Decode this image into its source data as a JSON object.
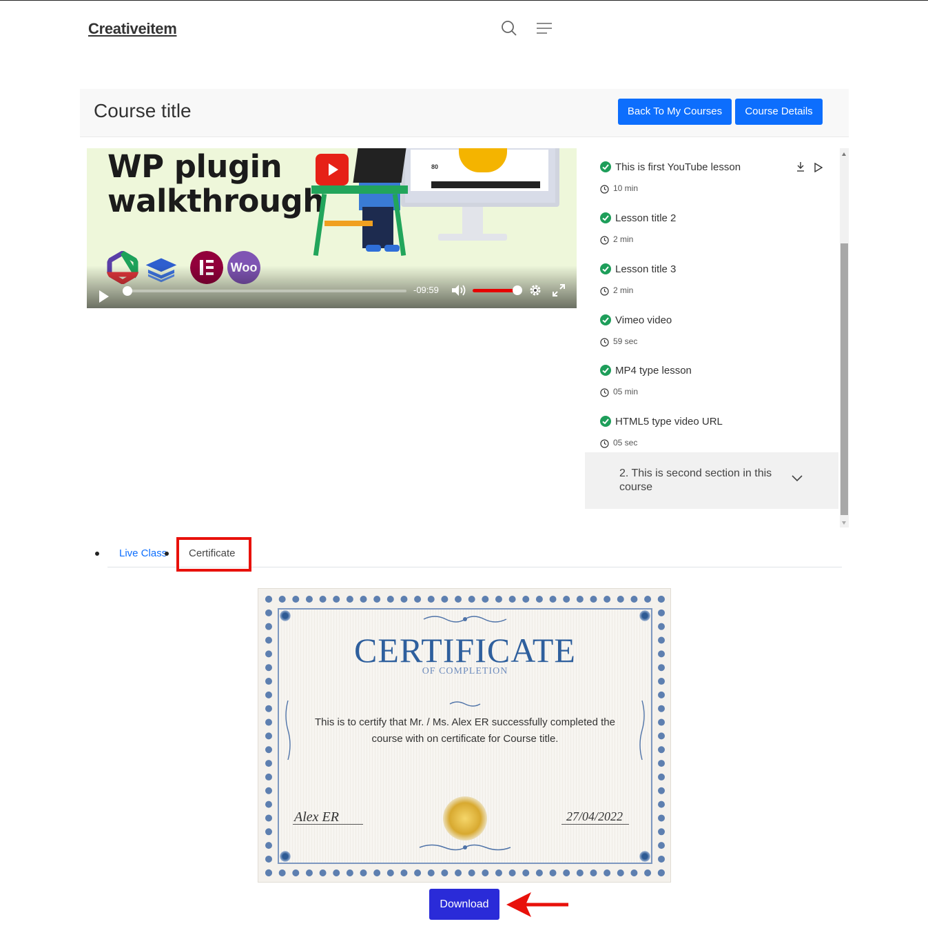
{
  "site": {
    "logo": "Creativeitem",
    "icons": {
      "search": "search-icon",
      "menu": "menu-icon"
    }
  },
  "course": {
    "title": "Course title",
    "back_button": "Back To My Courses",
    "details_button": "Course Details"
  },
  "player": {
    "video_heading_line1": "WP plugin",
    "video_heading_line2": "walkthrough",
    "badge_views": "80",
    "woo_badge": "Woo",
    "time_remaining": "-09:59",
    "progress": 0.0,
    "volume": 1.0,
    "icons": [
      "play-icon",
      "volume-icon",
      "settings-gear-icon",
      "fullscreen-icon",
      "youtube-play-icon"
    ]
  },
  "lessons": [
    {
      "title": "This is first YouTube lesson",
      "duration": "10 min",
      "completed": true
    },
    {
      "title": "Lesson title 2",
      "duration": "2 min",
      "completed": true
    },
    {
      "title": "Lesson title 3",
      "duration": "2 min",
      "completed": true
    },
    {
      "title": "Vimeo video",
      "duration": "59 sec",
      "completed": true
    },
    {
      "title": "MP4 type lesson",
      "duration": "05 min",
      "completed": true
    },
    {
      "title": "HTML5 type video URL",
      "duration": "05 sec",
      "completed": true
    }
  ],
  "section2": {
    "title": "2. This is second section in this course"
  },
  "tabs": [
    {
      "label": "Live Class",
      "active": false
    },
    {
      "label": "Certificate",
      "active": true
    }
  ],
  "certificate": {
    "heading": "CERTIFICATE",
    "subheading": "OF COMPLETION",
    "body": "This is to certify that Mr. / Ms. Alex ER successfully completed the course with on certificate for Course title.",
    "signature": "Alex ER",
    "date": "27/04/2022"
  },
  "download_button": "Download",
  "colors": {
    "primary": "#0d6efd",
    "download": "#2a2bd8",
    "highlight": "#e8110b",
    "check": "#1e9e5a",
    "cert_blue": "#2e5f9d"
  }
}
